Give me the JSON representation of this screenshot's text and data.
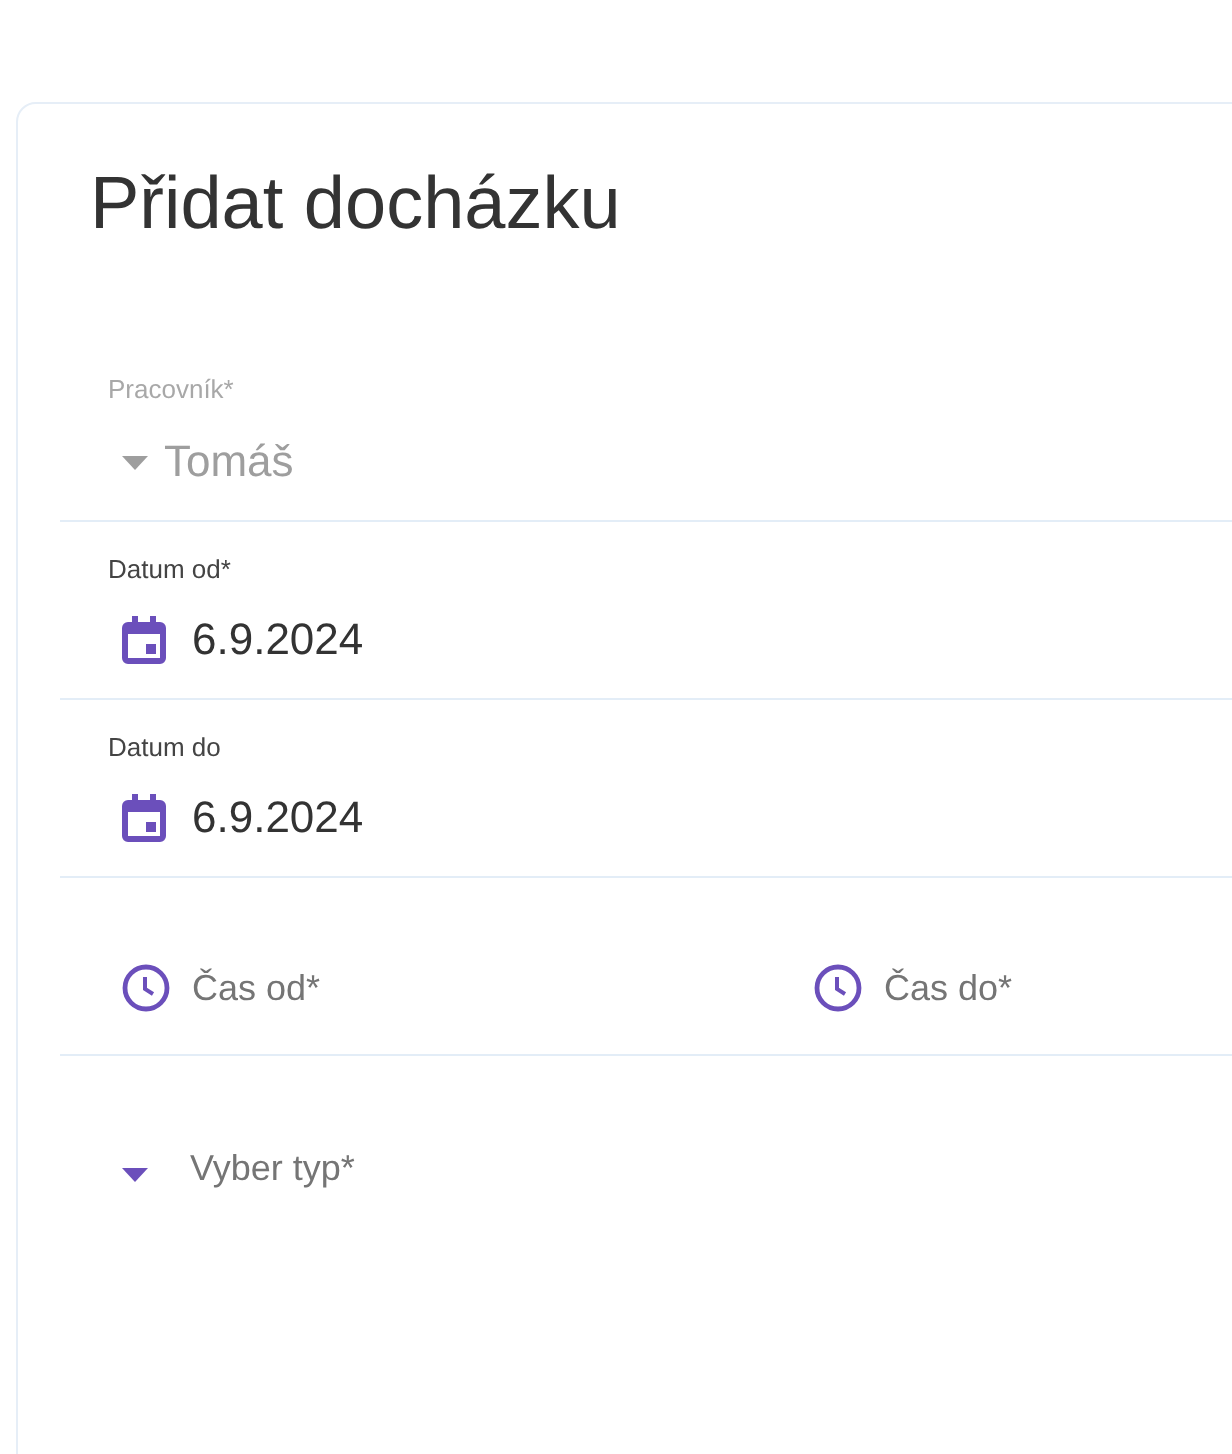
{
  "title": "Přidat docházku",
  "rows": [
    {
      "kind": "select",
      "label": "Pracovník*",
      "value": "Tomáš",
      "disabled": true
    },
    {
      "kind": "date",
      "label": "Datum od*",
      "value": "6.9.2024"
    },
    {
      "kind": "date",
      "label": "Datum do",
      "value": "6.9.2024"
    },
    {
      "kind": "times",
      "fields": [
        {
          "placeholder": "Čas od*"
        },
        {
          "placeholder": "Čas do*"
        }
      ]
    },
    {
      "kind": "select",
      "placeholder": "Vyber typ*",
      "disabled": false
    }
  ]
}
